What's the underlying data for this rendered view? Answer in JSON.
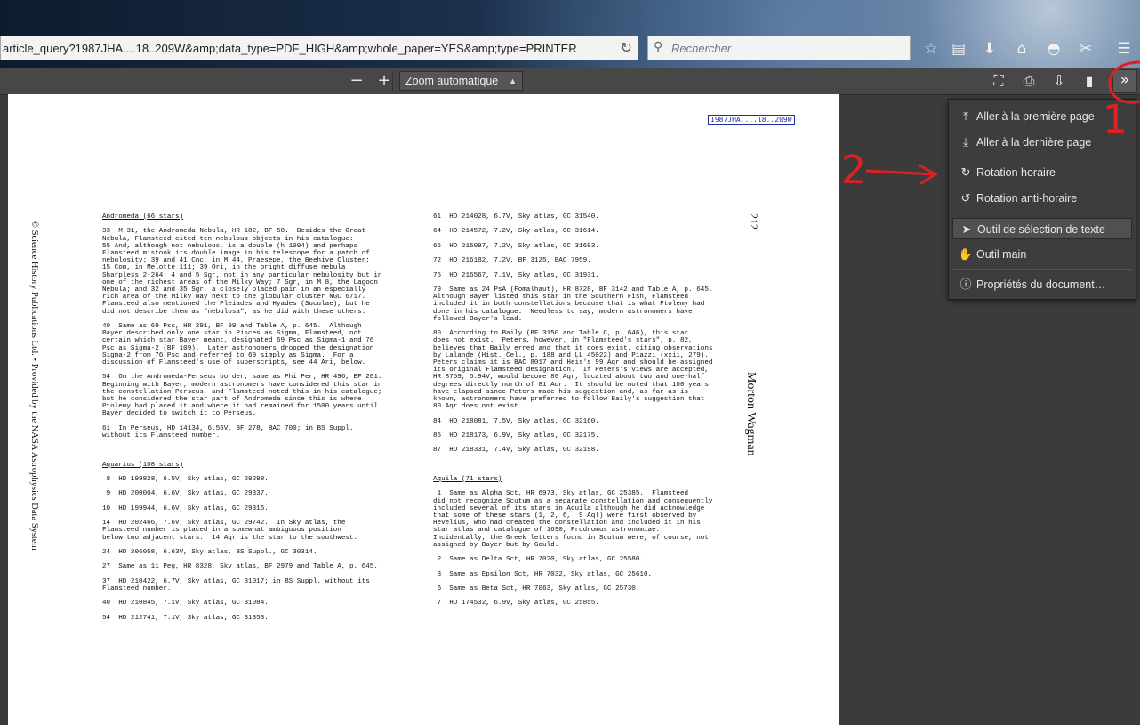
{
  "browser": {
    "url_value": "article_query?1987JHA....18..209W&amp;data_type=PDF_HIGH&amp;whole_paper=YES&amp;type=PRINTER",
    "search_placeholder": "Rechercher"
  },
  "pdf_toolbar": {
    "zoom_out": "−",
    "zoom_in": "+",
    "zoom_value": "Zoom automatique",
    "secondary_toolbar": "»"
  },
  "document": {
    "ads_reference": "1987JHA....18..209W",
    "copyright_margin": "© Science History Publications Ltd. • Provided by the NASA Astrophysics Data System",
    "page_number": "212",
    "author": "Morton Wagman",
    "left_column": [
      {
        "type": "h",
        "text": "Andromeda (66 stars)"
      },
      {
        "type": "p",
        "text": "33  M 31, the Andromeda Nebula, HR 182, BF 58.  Besides the Great\nNebula, Flamsteed cited ten nebulous objects in his catalogue:\n55 And, although not nebulous, is a double (h 1094) and perhaps\nFlamsteed mistook its double image in his telescope for a patch of\nnebulosity; 39 and 41 Cnc, in M 44, Praesepe, the Beehive Cluster;\n15 Com, in Melotte 111; 39 Ori, in the bright diffuse nebula\nSharpless 2-264; 4 and 5 Sgr, not in any particular nebulosity but in\none of the richest areas of the Milky Way; 7 Sgr, in M 8, the Lagoon\nNebula; and 32 and 35 Sgr, a closely placed pair in an especially\nrich area of the Milky Way next to the globular cluster NGC 6717.\nFlamsteed also mentioned the Pleiades and Hyades (Suculae), but he\ndid not describe them as \"nebulosa\", as he did with these others."
      },
      {
        "type": "p",
        "text": "40  Same as 69 Psc, HR 291, BF 99 and Table A, p. 645.  Although\nBayer described only one star in Pisces as Sigma, Flamsteed, not\ncertain which star Bayer meant, designated 69 Psc as Sigma-1 and 76\nPsc as Sigma-2 (BF 109).  Later astronomers dropped the designation\nSigma-2 from 76 Psc and referred to 69 simply as Sigma.  For a\ndiscussion of Flamsteed's use of superscripts, see 44 Ari, below."
      },
      {
        "type": "p",
        "text": "54  On the Andromeda-Perseus border, same as Phi Per, HR 496, BF 201.\nBeginning with Bayer, modern astronomers have considered this star in\nthe constellation Perseus, and Flamsteed noted this in his catalogue;\nbut he considered the star part of Andromeda since this is where\nPtolemy had placed it and where it had remained for 1500 years until\nBayer decided to switch it to Perseus."
      },
      {
        "type": "p",
        "text": "61  In Perseus, HD 14134, 6.55V, BF 278, BAC 700; in BS Suppl.\nwithout its Flamsteed number."
      },
      {
        "type": "sp",
        "text": ""
      },
      {
        "type": "h",
        "text": "Aquarius (108 stars)"
      },
      {
        "type": "p",
        "text": " 8  HD 199828, 6.5V, Sky atlas, GC 29298."
      },
      {
        "type": "p",
        "text": " 9  HD 200004, 6.6V, Sky atlas, GC 29337."
      },
      {
        "type": "p",
        "text": "10  HD 199944, 6.6V, Sky atlas, GC 29316."
      },
      {
        "type": "p",
        "text": "14  HD 202466, 7.6V, Sky atlas, GC 29742.  In Sky atlas, the\nFlamsteed number is placed in a somewhat ambiguous position\nbelow two adjacent stars.  14 Aqr is the star to the southwest."
      },
      {
        "type": "p",
        "text": "24  HD 206058, 6.63V, Sky atlas, BS Suppl., GC 30314."
      },
      {
        "type": "p",
        "text": "27  Same as 11 Peg, HR 8328, Sky atlas, BF 2979 and Table A, p. 645."
      },
      {
        "type": "p",
        "text": "37  HD 210422, 6.7V, Sky atlas, GC 31017; in BS Suppl. without its\nFlamsteed number."
      },
      {
        "type": "p",
        "text": "40  HD 210845, 7.1V, Sky atlas, GC 31084."
      },
      {
        "type": "p",
        "text": "54  HD 212741, 7.1V, Sky atlas, GC 31353."
      }
    ],
    "right_column": [
      {
        "type": "p",
        "text": "61  HD 214028, 6.7V, Sky atlas, GC 31540."
      },
      {
        "type": "p",
        "text": "64  HD 214572, 7.2V, Sky atlas, GC 31614."
      },
      {
        "type": "p",
        "text": "65  HD 215097, 7.2V, Sky atlas, GC 31693."
      },
      {
        "type": "p",
        "text": "72  HD 216182, 7.2V, BF 3125, BAC 7959."
      },
      {
        "type": "p",
        "text": "75  HD 216567, 7.1V, Sky atlas, GC 31931."
      },
      {
        "type": "p",
        "text": "79  Same as 24 PsA (Fomalhaut), HR 8728, BF 3142 and Table A, p. 645.\nAlthough Bayer listed this star in the Southern Fish, Flamsteed\nincluded it in both constellations because that is what Ptolemy had\ndone in his catalogue.  Needless to say, modern astronomers have\nfollowed Bayer's lead."
      },
      {
        "type": "p",
        "text": "80  According to Baily (BF 3150 and Table C, p. 646), this star\ndoes not exist.  Peters, however, in \"Flamsteed's stars\", p. 82,\nbelieves that Baily erred and that it does exist, citing observations\nby Lalande (Hist. Cel., p. 188 and LL 45022) and Piazzi (xxii, 279).\nPeters claims it is BAC 8017 and Heis's 99 Aqr and should be assigned\nits original Flamsteed designation.  If Peters's views are accepted,\nHR 8759, 5.94V, would become 80 Aqr, located about two and one-half\ndegrees directly north of 81 Aqr.  It should be noted that 100 years\nhave elapsed since Peters made his suggestion and, as far as is\nknown, astronomers have preferred to follow Baily's suggestion that\n80 Aqr does not exist."
      },
      {
        "type": "p",
        "text": "84  HD 218081, 7.5V, Sky atlas, GC 32160."
      },
      {
        "type": "p",
        "text": "85  HD 218173, 6.9V, Sky atlas, GC 32175."
      },
      {
        "type": "p",
        "text": "87  HD 218331, 7.4V, Sky atlas, GC 32198."
      },
      {
        "type": "sp",
        "text": ""
      },
      {
        "type": "h",
        "text": "Aquila (71 stars)"
      },
      {
        "type": "p",
        "text": " 1  Same as Alpha Sct, HR 6973, Sky atlas, GC 25385.  Flamsteed\ndid not recognize Scutum as a separate constellation and consequently\nincluded several of its stars in Aquila although he did acknowledge\nthat some of these stars (1, 2, 6,  9 Aql) were first observed by\nHevelius, who had created the constellation and included it in his\nstar atlas and catalogue of 1690, Prodromus astronomiae.\nIncidentally, the Greek letters found in Scutum were, of course, not\nassigned by Bayer but by Gould."
      },
      {
        "type": "p",
        "text": " 2  Same as Delta Sct, HR 7020, Sky atlas, GC 25580."
      },
      {
        "type": "p",
        "text": " 3  Same as Epsilon Sct, HR 7032, Sky atlas, GC 25610."
      },
      {
        "type": "p",
        "text": " 6  Same as Beta Sct, HR 7063, Sky atlas, GC 25730."
      },
      {
        "type": "p",
        "text": " 7  HD 174532, 6.9V, Sky atlas, GC 25855."
      }
    ]
  },
  "menu": {
    "items": [
      {
        "label": "Aller à la première page",
        "icon": "first-page-icon",
        "glyph": "⤒"
      },
      {
        "label": "Aller à la dernière page",
        "icon": "last-page-icon",
        "glyph": "⤓"
      },
      {
        "label": "Rotation horaire",
        "icon": "rotate-cw-icon",
        "glyph": "↻"
      },
      {
        "label": "Rotation anti-horaire",
        "icon": "rotate-ccw-icon",
        "glyph": "↺"
      },
      {
        "label": "Outil de sélection de texte",
        "icon": "cursor-icon",
        "glyph": "➤"
      },
      {
        "label": "Outil main",
        "icon": "hand-icon",
        "glyph": "✋"
      },
      {
        "label": "Propriétés du document…",
        "icon": "info-icon",
        "glyph": "ⓘ"
      }
    ]
  },
  "annotations": {
    "one": "1",
    "two": "2"
  }
}
